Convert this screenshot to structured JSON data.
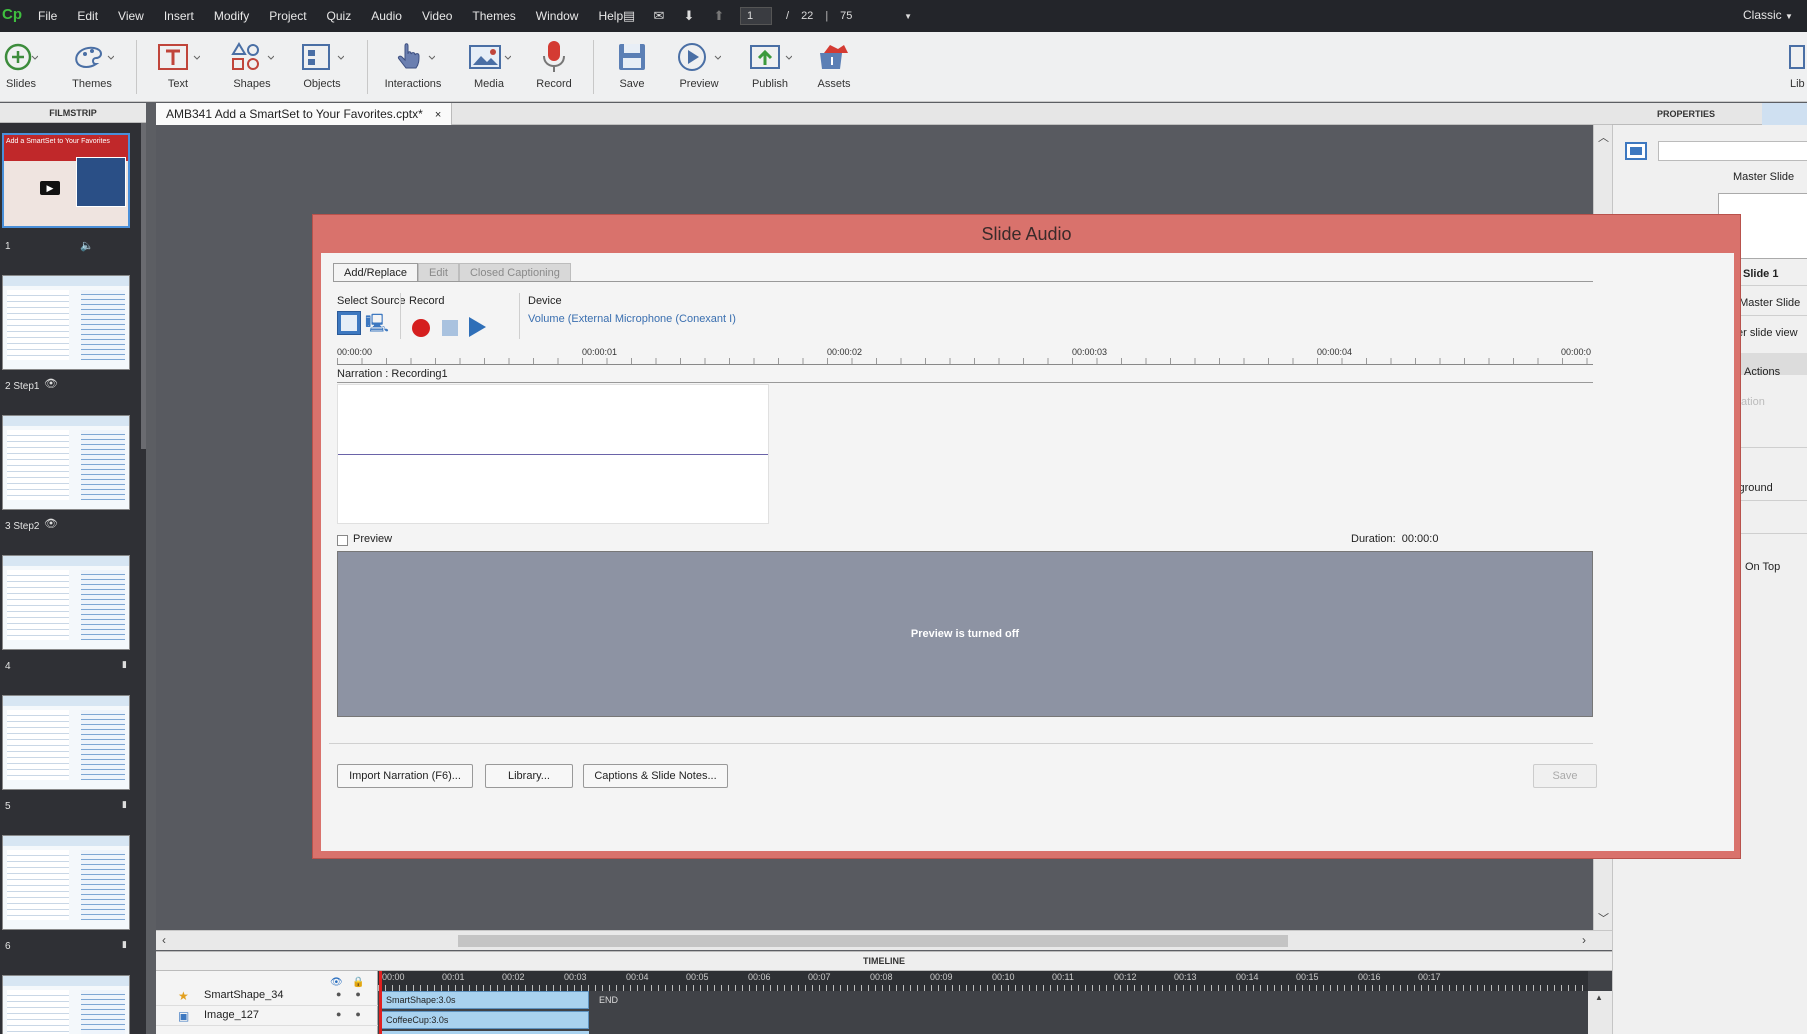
{
  "app": {
    "logo": "Cp",
    "mode": "Classic"
  },
  "menu": [
    "File",
    "Edit",
    "View",
    "Insert",
    "Modify",
    "Project",
    "Quiz",
    "Audio",
    "Video",
    "Themes",
    "Window",
    "Help"
  ],
  "nav": {
    "current_page": "1",
    "sep": "/",
    "total_pages": "22",
    "zoom": "75"
  },
  "toolbar": [
    {
      "id": "slides",
      "label": "Slides"
    },
    {
      "id": "themes",
      "label": "Themes"
    },
    {
      "id": "text",
      "label": "Text"
    },
    {
      "id": "shapes",
      "label": "Shapes"
    },
    {
      "id": "objects",
      "label": "Objects"
    },
    {
      "id": "interactions",
      "label": "Interactions"
    },
    {
      "id": "media",
      "label": "Media"
    },
    {
      "id": "record",
      "label": "Record"
    },
    {
      "id": "save",
      "label": "Save"
    },
    {
      "id": "preview",
      "label": "Preview"
    },
    {
      "id": "publish",
      "label": "Publish"
    },
    {
      "id": "assets",
      "label": "Assets"
    },
    {
      "id": "library",
      "label": "Lib"
    }
  ],
  "filmstrip": {
    "header": "FILMSTRIP",
    "slides": [
      {
        "label": "1",
        "title": "Add a SmartSet to Your Favorites"
      },
      {
        "label": "2 Step1"
      },
      {
        "label": "3 Step2"
      },
      {
        "label": "4"
      },
      {
        "label": "5"
      },
      {
        "label": "6"
      },
      {
        "label": ""
      }
    ]
  },
  "document": {
    "tab_title": "AMB341 Add a SmartSet to Your Favorites.cptx*",
    "close": "×"
  },
  "properties": {
    "header": "PROPERTIES",
    "master_slide": "Master Slide",
    "slide_name": "Slide 1",
    "use_master": ": Master Slide",
    "master_view": "er slide view",
    "actions": "Actions",
    "faded": "ation",
    "background": "kground",
    "on_top": "On Top"
  },
  "dialog": {
    "title": "Slide Audio",
    "tabs": [
      "Add/Replace",
      "Edit",
      "Closed Captioning"
    ],
    "select_source": "Select Source",
    "record": "Record",
    "device_label": "Device",
    "device_value": "Volume (External Microphone (Conexant I)",
    "ruler": [
      "00:00:00",
      "00:00:01",
      "00:00:02",
      "00:00:03",
      "00:00:04",
      "00:00:0"
    ],
    "narration": "Narration : Recording1",
    "preview_label": "Preview",
    "duration_label": "Duration:",
    "duration_value": "00:00:0",
    "preview_message": "Preview is turned off",
    "buttons": {
      "import": "Import Narration (F6)...",
      "library": "Library...",
      "captions": "Captions & Slide Notes...",
      "save": "Save"
    }
  },
  "timeline": {
    "header": "TIMELINE",
    "ruler": [
      "00:00",
      "00:01",
      "00:02",
      "00:03",
      "00:04",
      "00:05",
      "00:06",
      "00:07",
      "00:08",
      "00:09",
      "00:10",
      "00:11",
      "00:12",
      "00:13",
      "00:14",
      "00:15",
      "00:16",
      "00:17"
    ],
    "rows": [
      {
        "name": "SmartShape_34",
        "bar": "SmartShape:3.0s"
      },
      {
        "name": "Image_127",
        "bar": "CoffeeCup:3.0s"
      }
    ],
    "end": "END"
  }
}
